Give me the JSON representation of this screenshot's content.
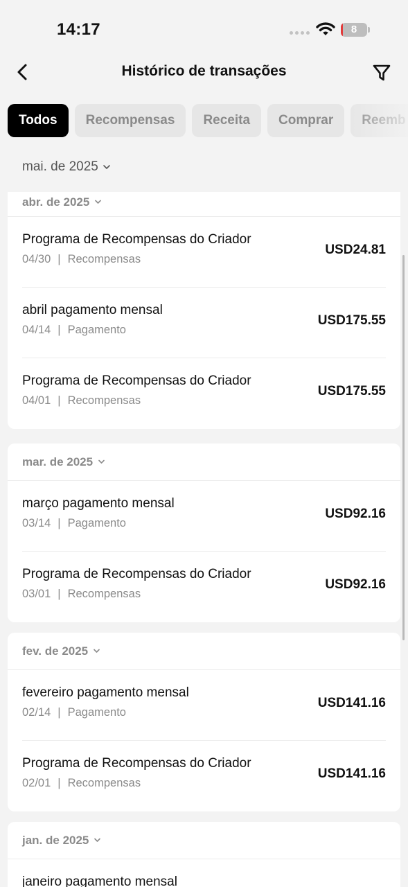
{
  "status_bar": {
    "time": "14:17",
    "battery": "8",
    "battery_percent": 8,
    "icons": [
      "signal-dots-icon",
      "wifi-icon",
      "battery-icon"
    ]
  },
  "header": {
    "title": "Histórico de transações",
    "back_icon": "chevron-left-icon",
    "filter_icon": "funnel-icon"
  },
  "tabs": [
    {
      "label": "Todos",
      "active": true
    },
    {
      "label": "Recompensas",
      "active": false
    },
    {
      "label": "Receita",
      "active": false
    },
    {
      "label": "Comprar",
      "active": false
    },
    {
      "label": "Reemb",
      "active": false
    }
  ],
  "month_selector": {
    "label": "mai. de 2025"
  },
  "groups": [
    {
      "label": "abr. de 2025",
      "transactions": [
        {
          "title": "Programa de Recompensas do Criador",
          "date": "04/30",
          "separator": "|",
          "type": "Recompensas",
          "amount": "USD24.81"
        },
        {
          "title": "abril pagamento mensal",
          "date": "04/14",
          "separator": "|",
          "type": "Pagamento",
          "amount": "USD175.55"
        },
        {
          "title": "Programa de Recompensas do Criador",
          "date": "04/01",
          "separator": "|",
          "type": "Recompensas",
          "amount": "USD175.55"
        }
      ]
    },
    {
      "label": "mar. de 2025",
      "transactions": [
        {
          "title": "março pagamento mensal",
          "date": "03/14",
          "separator": "|",
          "type": "Pagamento",
          "amount": "USD92.16"
        },
        {
          "title": "Programa de Recompensas do Criador",
          "date": "03/01",
          "separator": "|",
          "type": "Recompensas",
          "amount": "USD92.16"
        }
      ]
    },
    {
      "label": "fev. de 2025",
      "transactions": [
        {
          "title": "fevereiro pagamento mensal",
          "date": "02/14",
          "separator": "|",
          "type": "Pagamento",
          "amount": "USD141.16"
        },
        {
          "title": "Programa de Recompensas do Criador",
          "date": "02/01",
          "separator": "|",
          "type": "Recompensas",
          "amount": "USD141.16"
        }
      ]
    },
    {
      "label": "jan. de 2025",
      "transactions": [
        {
          "title": "janeiro pagamento mensal"
        }
      ]
    }
  ]
}
